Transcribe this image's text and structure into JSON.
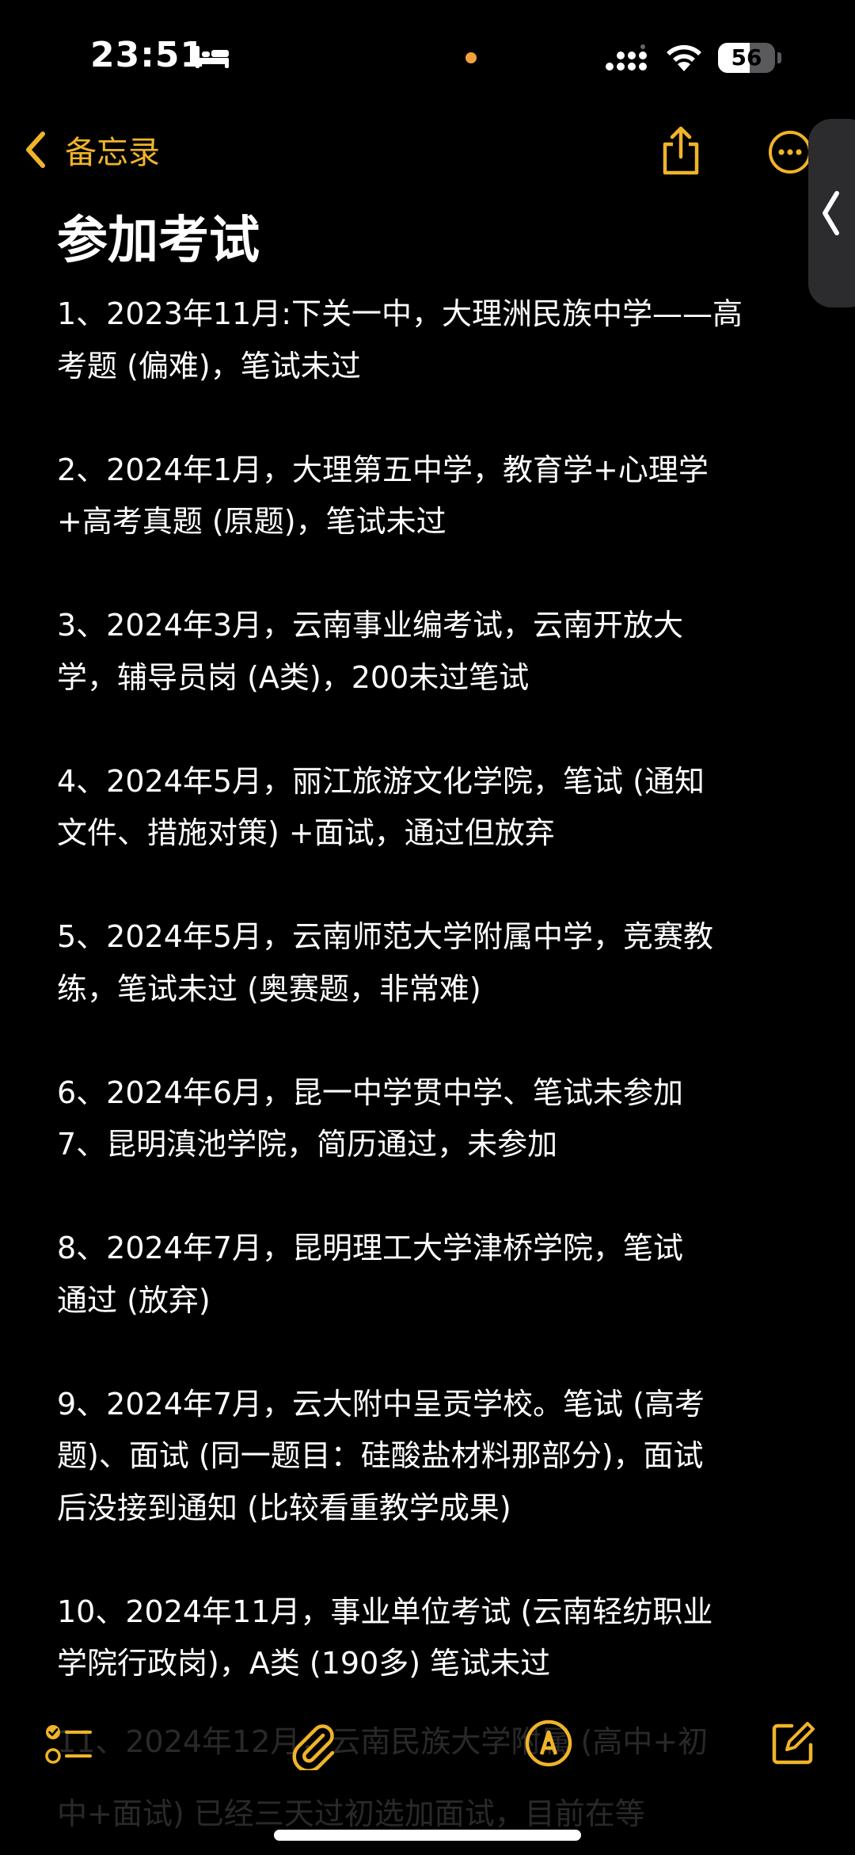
{
  "status_bar": {
    "time": "23:51",
    "battery_level": "56",
    "battery_percent": 56,
    "icons": [
      "bed-icon",
      "signal-icon",
      "wifi-icon",
      "battery-icon"
    ]
  },
  "nav": {
    "back_label": "备忘录",
    "icons": [
      "chevron-left-icon",
      "share-icon",
      "more-icon"
    ]
  },
  "note": {
    "title": "参加考试",
    "lines": [
      "1、2023年11月:下关一中，大理洲民族中学——高",
      "考题 (偏难)，笔试未过",
      "",
      "2、2024年1月，大理第五中学，教育学+心理学",
      "+高考真题 (原题)，笔试未过",
      "",
      "3、2024年3月，云南事业编考试，云南开放大",
      "学，辅导员岗 (A类)，200未过笔试",
      "",
      "4、2024年5月，丽江旅游文化学院，笔试 (通知",
      "文件、措施对策) +面试，通过但放弃",
      "",
      "5、2024年5月，云南师范大学附属中学，竞赛教",
      "练，笔试未过 (奥赛题，非常难)",
      "",
      "6、2024年6月，昆一中学贯中学、笔试未参加",
      "7、昆明滇池学院，简历通过，未参加",
      "",
      "8、2024年7月，昆明理工大学津桥学院，笔试",
      "通过 (放弃)",
      "",
      "9、2024年7月，云大附中呈贡学校。笔试 (高考",
      "题)、面试 (同一题目：硅酸盐材料那部分)，面试",
      "后没接到通知 (比较看重教学成果)",
      "",
      "10、2024年11月，事业单位考试 (云南轻纺职业",
      "学院行政岗)，A类 (190多) 笔试未过"
    ],
    "overflow_lines": [
      "11、2024年12月，云南民族大学附属 (高中+初",
      "中+面试) 已经三天过初选加面试，目前在等"
    ]
  },
  "toolbar": {
    "icons": [
      "checklist-icon",
      "attachment-icon",
      "markup-icon",
      "compose-icon"
    ]
  },
  "colors": {
    "accent": "#f0b429",
    "background": "#000000",
    "text": "#ffffff",
    "status_dot": "#f4a13d"
  }
}
